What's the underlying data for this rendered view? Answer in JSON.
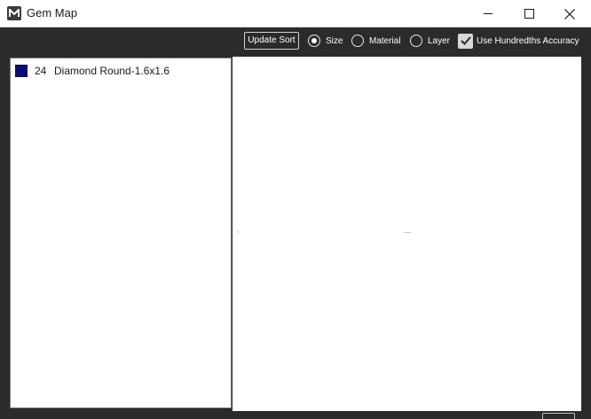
{
  "window": {
    "title": "Gem Map",
    "icon": "m-logo-icon"
  },
  "toolbar": {
    "update_sort_label": "Update Sort",
    "sort_options": [
      {
        "label": "Size",
        "selected": true
      },
      {
        "label": "Material",
        "selected": false
      },
      {
        "label": "Layer",
        "selected": false
      }
    ],
    "hundredths": {
      "label": "Use Hundredths Accuracy",
      "checked": true
    }
  },
  "gem_list": {
    "items": [
      {
        "count": "24",
        "name": "Diamond Round-1.6x1.6",
        "color": "#0a0a7a"
      }
    ]
  },
  "colors": {
    "background": "#2b2b2b",
    "panel": "#ffffff",
    "swatch": "#0a0a7a"
  }
}
